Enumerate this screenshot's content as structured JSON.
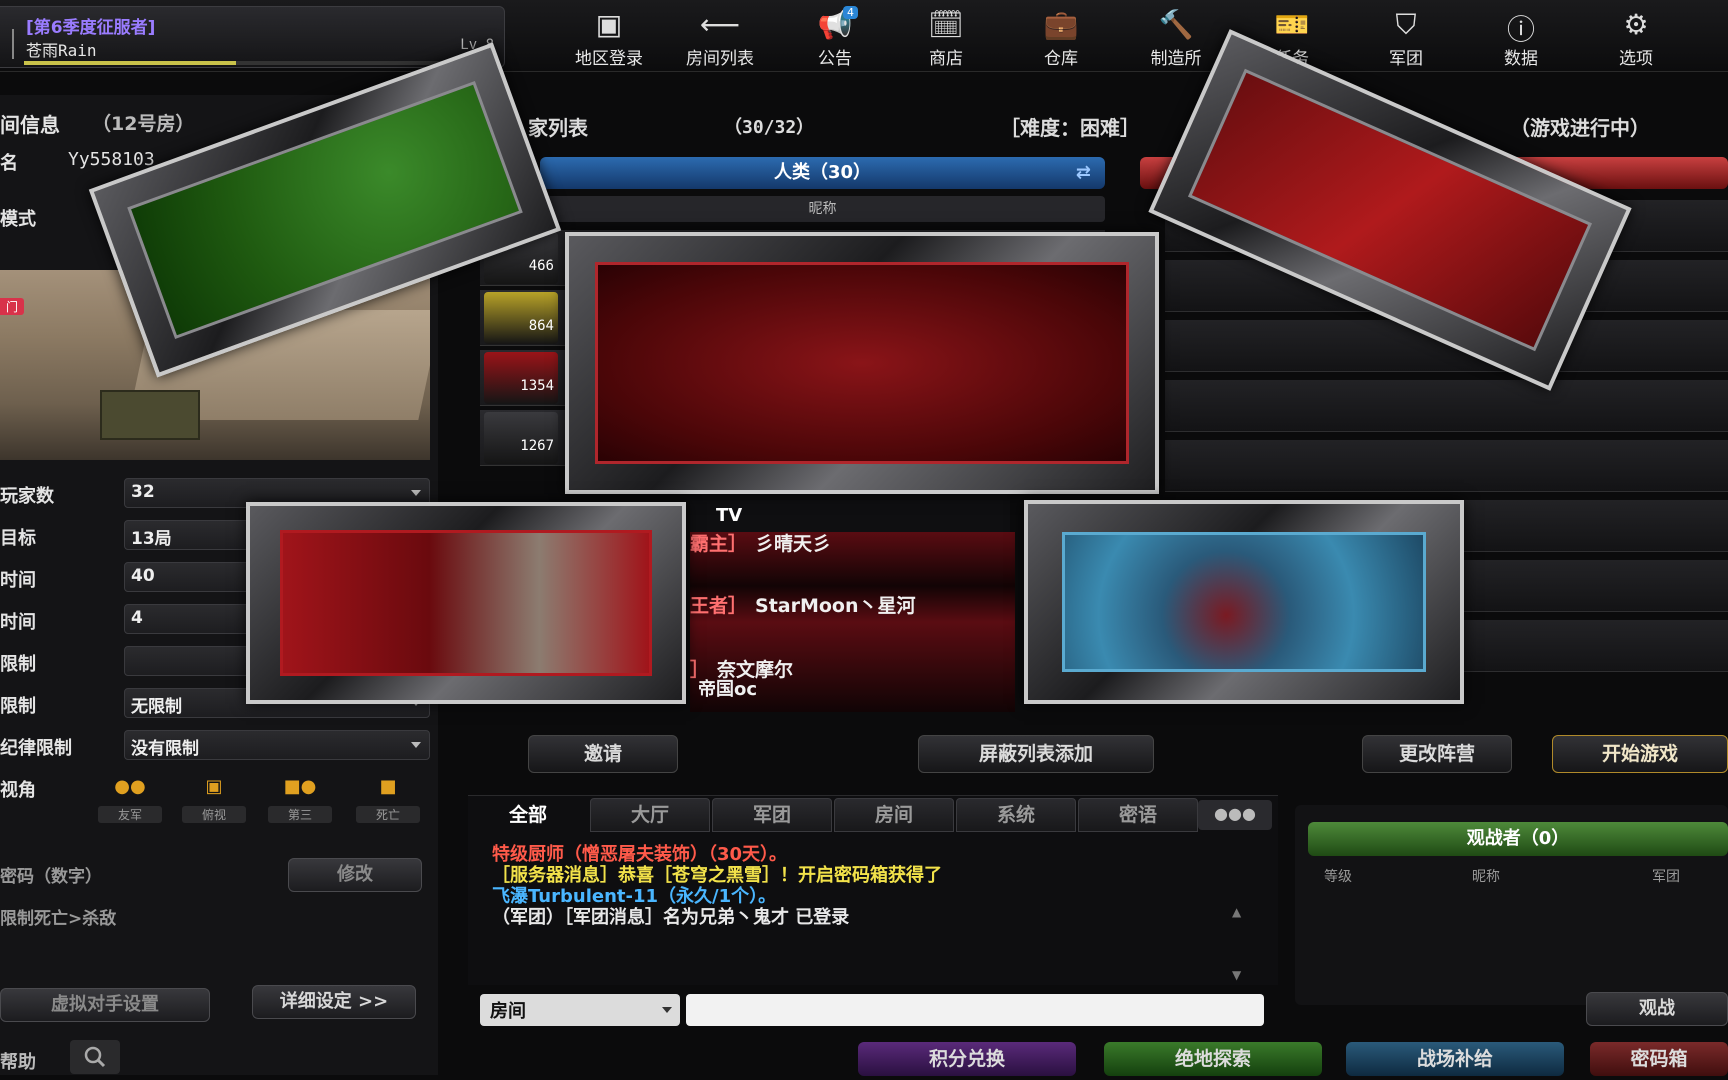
{
  "profile": {
    "season": "[第6季度征服者]",
    "name": "苍雨Rain",
    "level": "Lv.8",
    "xp_fraction": 0.45
  },
  "nav": [
    {
      "id": "region",
      "label": "地区登录",
      "icon": "region-login-icon"
    },
    {
      "id": "rooms",
      "label": "房间列表",
      "icon": "back-arrow-icon"
    },
    {
      "id": "notice",
      "label": "公告",
      "icon": "megaphone-icon",
      "badge": "4"
    },
    {
      "id": "shop",
      "label": "商店",
      "icon": "shop-icon"
    },
    {
      "id": "storage",
      "label": "仓库",
      "icon": "briefcase-icon"
    },
    {
      "id": "workshop",
      "label": "制造所",
      "icon": "hammer-icon"
    },
    {
      "id": "mission",
      "label": "任务",
      "icon": "mission-ticket-icon"
    },
    {
      "id": "clan",
      "label": "军团",
      "icon": "clan-shield-icon"
    },
    {
      "id": "stats",
      "label": "数据",
      "icon": "info-exclamation-icon"
    },
    {
      "id": "options",
      "label": "选项",
      "icon": "gear-icon"
    }
  ],
  "room_info": {
    "title": "间信息",
    "room_no": "（12号房）",
    "name_label": "名",
    "name_value": "Yy558103",
    "mode_label": "模式",
    "map_tag": "门",
    "fields": [
      {
        "label": "玩家数",
        "value": "32"
      },
      {
        "label": "目标",
        "value": "13局"
      },
      {
        "label": "时间",
        "value": "40"
      },
      {
        "label": "时间",
        "value": "4"
      },
      {
        "label": "限制",
        "value": ""
      },
      {
        "label": "限制",
        "value": "无限制"
      },
      {
        "label": "纪律限制",
        "value": "没有限制"
      }
    ],
    "view_label": "视角",
    "view_options": [
      "友军",
      "俯视",
      "第三",
      "死亡"
    ],
    "password_label": "密码（数字）",
    "modify_btn": "修改",
    "death_limit": "限制死亡>杀敌",
    "bot_btn": "虚拟对手设置",
    "detail_btn": "详细设定 >>",
    "help_label": "帮助"
  },
  "player_list": {
    "title": "家列表",
    "count": "（30/32）",
    "difficulty": "［难度：困难］",
    "status": "（游戏进行中）",
    "human_team": "人类（30）",
    "column_nick": "昵称",
    "levels": [
      "466",
      "864",
      "1354",
      "1267"
    ],
    "tv_label": "TV",
    "players": [
      {
        "tag": "霸主］",
        "name": "彡晴天彡"
      },
      {
        "tag": "王者］",
        "name": "StarMoon丶星河"
      },
      {
        "tag": "］",
        "name": "奈文摩尔"
      },
      {
        "tag": "",
        "name": "帝国oc"
      }
    ]
  },
  "actions": {
    "invite": "邀请",
    "block": "屏蔽列表添加",
    "change_team": "更改阵营",
    "start": "开始游戏"
  },
  "chat": {
    "tabs": [
      "全部",
      "大厅",
      "军团",
      "房间",
      "系统",
      "密语"
    ],
    "lines": [
      {
        "text": "特级厨师（憎恶屠夫装饰）（30天）。",
        "color": "#ff5a4a"
      },
      {
        "text": "［服务器消息］恭喜［苍穹之黑雪］！开启密码箱获得了",
        "color": "#f2e24a"
      },
      {
        "text": "飞瀑Turbulent-11（永久/1个）。",
        "color": "#4ab6ff"
      },
      {
        "text": "（军团）［军团消息］名为兄弟丶鬼才 已登录",
        "color": "#e8e8e8"
      }
    ],
    "channel": "房间"
  },
  "spectators": {
    "title": "观战者（0）",
    "col_level": "等级",
    "col_nick": "昵称",
    "col_clan": "军团",
    "watch_btn": "观战"
  },
  "bottom": [
    "积分兑换",
    "绝地探索",
    "战场补给",
    "密码箱"
  ],
  "colors": {
    "human_blue": "#2c6bb0",
    "zombie_red": "#c84040",
    "spectator_green": "#4e8a3a",
    "season_purple": "#9a7cff"
  }
}
